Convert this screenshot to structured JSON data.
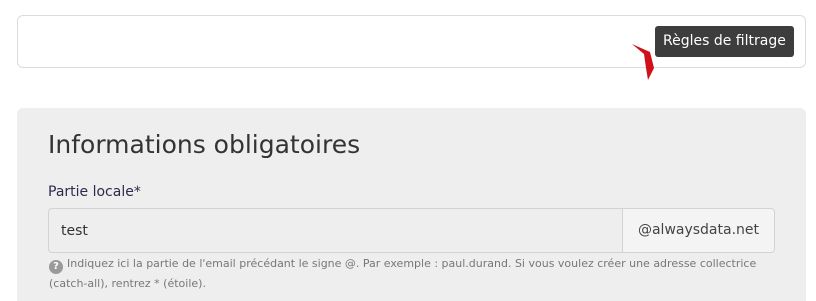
{
  "tooltip": {
    "text": "Règles de filtrage"
  },
  "form": {
    "section_title": "Informations obligatoires",
    "local_part": {
      "label": "Partie locale*",
      "value": "test",
      "domain_suffix": "@alwaysdata.net",
      "help_text": "Indiquez ici la partie de l'email précédant le signe @. Par exemple : paul.durand. Si vous voulez créer une adresse collectrice (catch-all), rentrez * (étoile).",
      "help_icon": "question-circle-icon"
    }
  },
  "colors": {
    "pointer": "#d0101a",
    "tooltip_bg": "#3d3d3d",
    "card_bg": "#eeeeee"
  }
}
